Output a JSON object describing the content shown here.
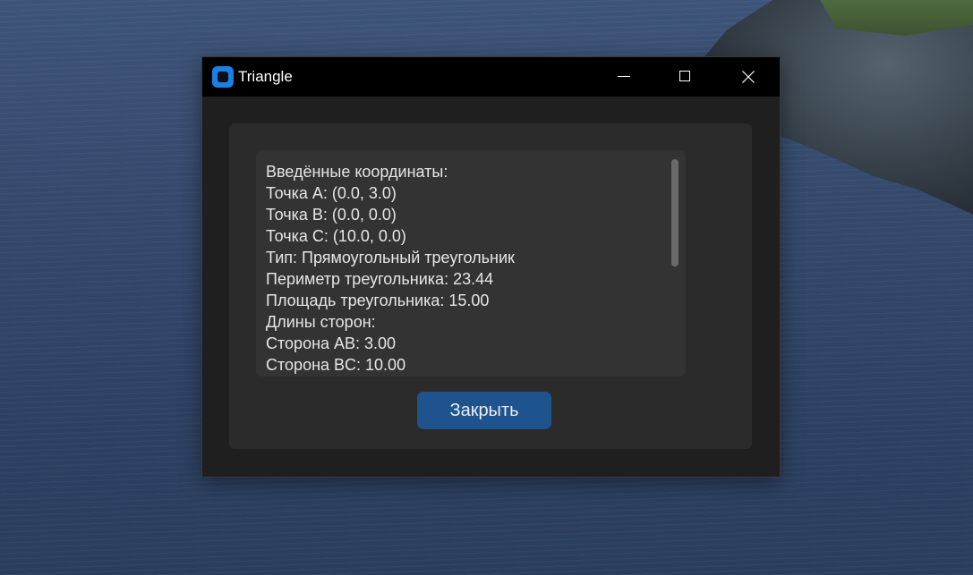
{
  "window": {
    "title": "Triangle"
  },
  "titlebar_buttons": {
    "minimize_icon": "minimize-icon",
    "maximize_icon": "maximize-icon",
    "close_icon": "close-icon"
  },
  "results": {
    "lines": [
      "Введённые координаты:",
      "Точка A: (0.0, 3.0)",
      "Точка B: (0.0, 0.0)",
      "Точка C: (10.0, 0.0)",
      "Тип: Прямоугольный треугольник",
      "Периметр треугольника: 23.44",
      "Площадь треугольника: 15.00",
      "Длины сторон:",
      "Сторона AB: 3.00",
      "Сторона BC: 10.00"
    ]
  },
  "actions": {
    "close_label": "Закрыть"
  },
  "colors": {
    "accent": "#1f538d",
    "app_icon": "#1c7fe6",
    "window_bg": "#1f1f1f",
    "panel_bg": "#2b2b2b",
    "textbox_bg": "#333333"
  }
}
